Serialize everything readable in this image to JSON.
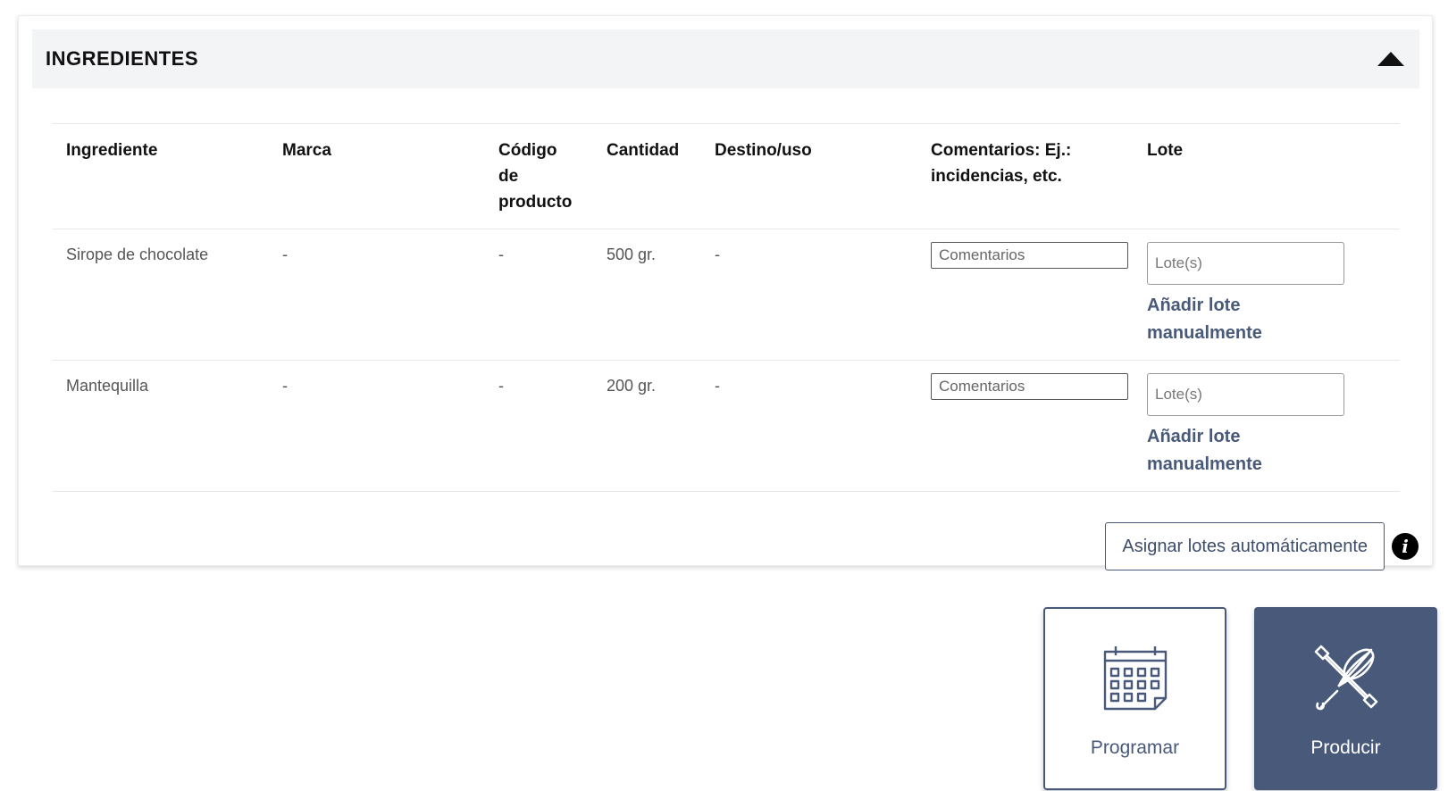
{
  "section": {
    "title": "INGREDIENTES",
    "toggle_icon": "caret-up-icon"
  },
  "table": {
    "headers": {
      "ingrediente": "Ingrediente",
      "marca": "Marca",
      "codigo": "Código de producto",
      "cantidad": "Cantidad",
      "destino": "Destino/uso",
      "comentarios": "Comentarios: Ej.: incidencias, etc.",
      "lote": "Lote"
    },
    "rows": [
      {
        "ingrediente": "Sirope de chocolate",
        "marca": "-",
        "codigo": "-",
        "cantidad": "500 gr.",
        "destino": "-",
        "comentarios_placeholder": "Comentarios",
        "comentarios_value": "",
        "lote_placeholder": "Lote(s)",
        "lote_value": "",
        "add_lote_label": "Añadir lote manualmente"
      },
      {
        "ingrediente": "Mantequilla",
        "marca": "-",
        "codigo": "-",
        "cantidad": "200 gr.",
        "destino": "-",
        "comentarios_placeholder": "Comentarios",
        "comentarios_value": "",
        "lote_placeholder": "Lote(s)",
        "lote_value": "",
        "add_lote_label": "Añadir lote manualmente"
      }
    ]
  },
  "assign_button": {
    "label": "Asignar lotes automáticamente",
    "info_icon": "info-icon"
  },
  "actions": {
    "programar": {
      "label": "Programar",
      "icon": "calendar-icon"
    },
    "producir": {
      "label": "Producir",
      "icon": "rolling-pin-whisk-icon"
    }
  },
  "colors": {
    "accent": "#48597a",
    "header_bg": "#f3f4f6"
  }
}
